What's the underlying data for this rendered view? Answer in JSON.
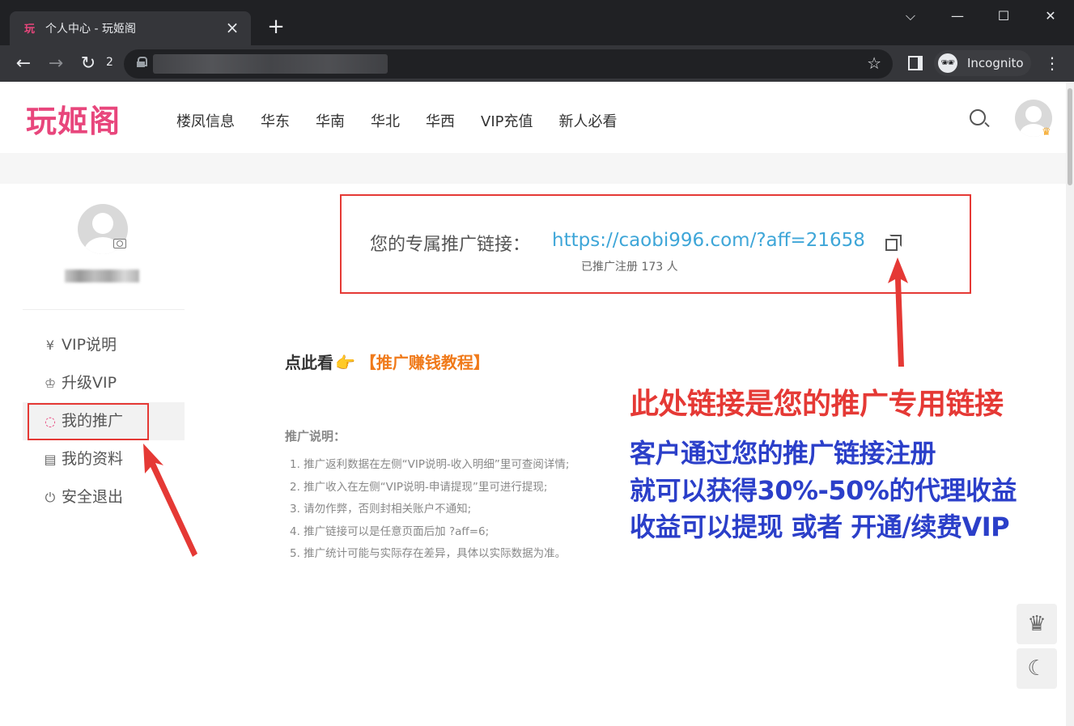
{
  "browser": {
    "tab_favicon": "玩",
    "tab_title": "个人中心 - 玩姬阁",
    "tab_close": "×",
    "new_tab": "+",
    "reload_count": "2",
    "incognito_label": "Incognito",
    "window_controls": [
      "⌵",
      "—",
      "☐",
      "✕"
    ]
  },
  "header": {
    "logo": "玩姬阁",
    "nav": [
      "楼凤信息",
      "华东",
      "华南",
      "华北",
      "华西",
      "VIP充值",
      "新人必看"
    ],
    "accent_color": "#e8467c"
  },
  "sidebar": {
    "menu": [
      {
        "icon": "yen-circle-icon",
        "glyph": "¥",
        "label": "VIP说明"
      },
      {
        "icon": "crown-outline-icon",
        "glyph": "♔",
        "label": "升级VIP"
      },
      {
        "icon": "loading-circle-icon",
        "glyph": "◌",
        "label": "我的推广",
        "active": true
      },
      {
        "icon": "id-card-icon",
        "glyph": "▤",
        "label": "我的资料"
      },
      {
        "icon": "power-icon",
        "glyph": "⏻",
        "label": "安全退出"
      }
    ]
  },
  "promo": {
    "label": "您的专属推广链接：",
    "link": "https://caobi996.com/?aff=21658",
    "count_text": "已推广注册 173 人"
  },
  "tutorial": {
    "prefix": "点此看",
    "hand": "👉",
    "link": "【推广赚钱教程】"
  },
  "notes": {
    "title": "推广说明：",
    "items": [
      "1. 推广返利数据在左侧“VIP说明-收入明细”里可查阅详情;",
      "2. 推广收入在左侧“VIP说明-申请提现”里可进行提现;",
      "3. 请勿作弊，否则封相关账户不通知;",
      "4. 推广链接可以是任意页面后加 ?aff=6;",
      "5. 推广统计可能与实际存在差异，具体以实际数据为准。"
    ]
  },
  "annotation": {
    "red_line": "此处链接是您的推广专用链接",
    "blue_lines": [
      "客户通过您的推广链接注册",
      "就可以获得30%-50%的代理收益",
      "收益可以提现 或者 开通/续费VIP"
    ],
    "red_color": "#e53935",
    "blue_color": "#2b3fc9"
  },
  "floating": {
    "crown_glyph": "♛",
    "moon_glyph": "☾"
  }
}
